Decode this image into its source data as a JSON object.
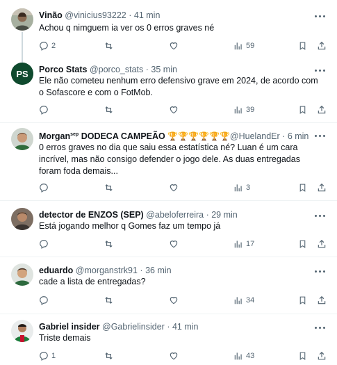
{
  "tweets": [
    {
      "name": "Vinão",
      "handle": "@vinicius93222",
      "time": "41 min",
      "text": "Achou q nimguem ia ver os 0 erros graves né",
      "reply_count": "2",
      "views": "59",
      "avatar_icon": "user-photo-icon"
    },
    {
      "name": "Porco Stats",
      "handle": "@porco_stats",
      "time": "35 min",
      "text": "Ele não cometeu nenhum erro defensivo grave em 2024, de acordo com o Sofascore e com o FotMob.",
      "reply_count": "",
      "views": "39",
      "avatar_initials": "PS",
      "avatar_color": "#0f4a2e"
    },
    {
      "name": "Morgan",
      "name_sup": "sep",
      "name_suffix": "DODECA CAMPEÃO",
      "trophies": "🏆🏆🏆🏆🏆🏆",
      "handle": "@HuelandEr",
      "time": "6 min",
      "text": "0 erros graves no dia que saiu essa estatística né? Luan é um cara incrível, mas não consigo defender o jogo dele. As duas entregadas foram foda demais...",
      "reply_count": "",
      "views": "3"
    },
    {
      "name": "detector de ENZOS (SEP)",
      "handle": "@abeloferreira",
      "time": "29 min",
      "text": "Está jogando melhor q Gomes faz um tempo já",
      "reply_count": "",
      "views": "17"
    },
    {
      "name": "eduardo",
      "handle": "@morganstrk91",
      "time": "36 min",
      "text": "cade a lista de entregadas?",
      "reply_count": "",
      "views": "34"
    },
    {
      "name": "Gabriel insider",
      "handle": "@Gabrielinsider",
      "time": "41 min",
      "text": "Triste demais",
      "reply_count": "1",
      "views": "43"
    }
  ],
  "separator": "·",
  "colors": {
    "text": "#0f1419",
    "muted": "#536471",
    "divider": "#eff3f4",
    "thread_line": "#cfd9de",
    "trophy": "#e8a317"
  },
  "icons": [
    "reply-icon",
    "retweet-icon",
    "like-icon",
    "views-icon",
    "bookmark-icon",
    "share-icon",
    "more-icon"
  ]
}
